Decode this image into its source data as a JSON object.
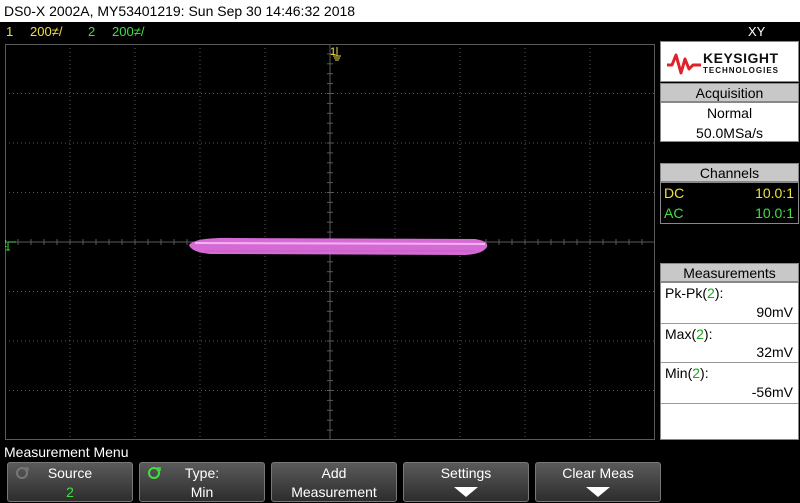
{
  "window": {
    "title": "DS0-X 2002A, MY53401219: Sun Sep 30 14:46:32 2018"
  },
  "status": {
    "ch1_number": "1",
    "ch1_scale": "200≠/",
    "ch2_number": "2",
    "ch2_scale": "200≠/",
    "mode": "XY"
  },
  "screen": {
    "marker_top": "1",
    "marker_left": "2"
  },
  "panel": {
    "brand": "KEYSIGHT",
    "brand_sub": "TECHNOLOGIES",
    "acquisition": {
      "header": "Acquisition",
      "mode": "Normal",
      "rate": "50.0MSa/s"
    },
    "channels": {
      "header": "Channels",
      "rows": [
        {
          "coupling": "DC",
          "probe": "10.0:1"
        },
        {
          "coupling": "AC",
          "probe": "10.0:1"
        }
      ]
    },
    "measurements": {
      "header": "Measurements",
      "items": [
        {
          "name": "Pk-Pk",
          "channel": "2",
          "value": "90mV"
        },
        {
          "name": "Max",
          "channel": "2",
          "value": "32mV"
        },
        {
          "name": "Min",
          "channel": "2",
          "value": "-56mV"
        }
      ]
    }
  },
  "menu": {
    "title": "Measurement Menu",
    "softkeys": [
      {
        "line1": "Source",
        "line2": "2"
      },
      {
        "line1": "Type:",
        "line2": "Min"
      },
      {
        "line1": "Add",
        "line2": "Measurement"
      },
      {
        "line1": "Settings",
        "line2": ""
      },
      {
        "line1": "Clear Meas",
        "line2": ""
      }
    ]
  },
  "colors": {
    "ch1": "#f0e040",
    "ch2": "#40e040",
    "trace": "#e070e0",
    "grid": "#5a5a5a",
    "accent_logo": "#e0202a"
  }
}
